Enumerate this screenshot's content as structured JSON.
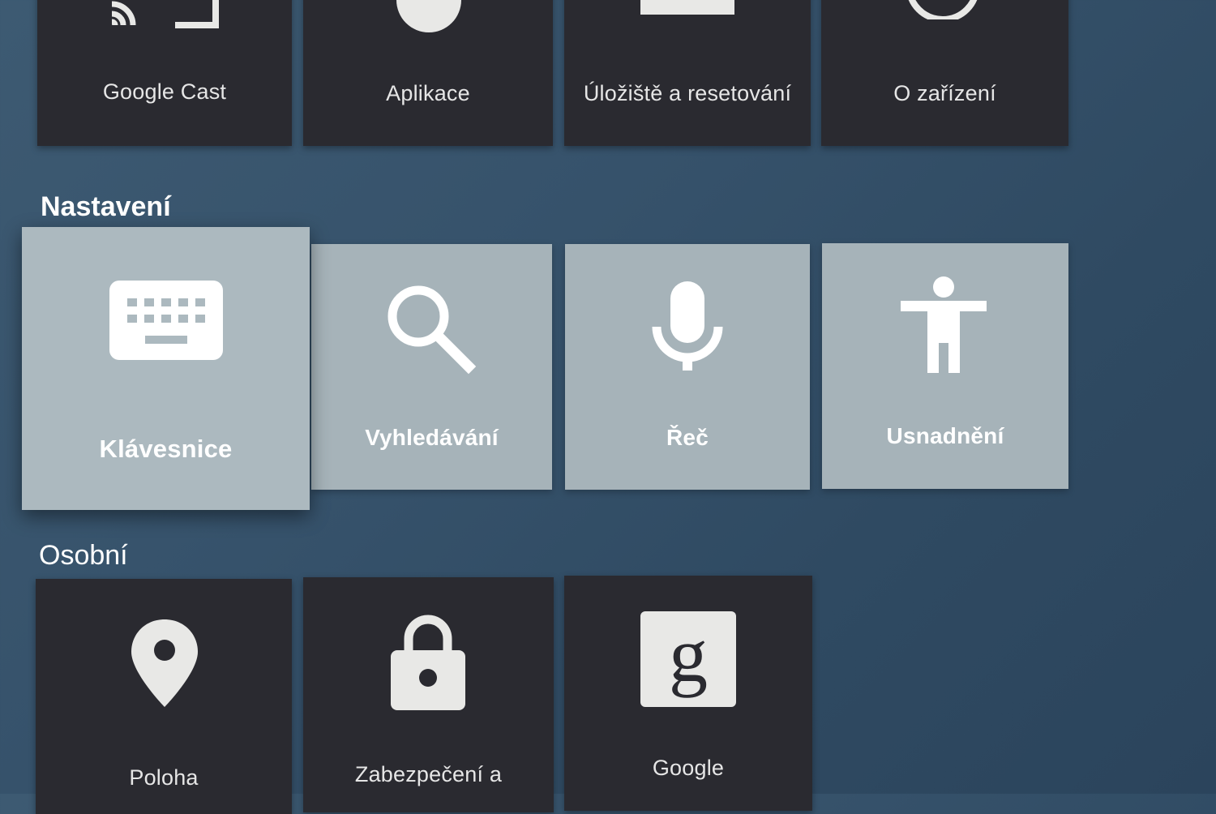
{
  "device_row": {
    "tiles": [
      {
        "label": "Google Cast",
        "icon": "cast-icon"
      },
      {
        "label": "Aplikace",
        "icon": "apps-icon"
      },
      {
        "label": "Úložiště a resetování",
        "icon": "storage-icon"
      },
      {
        "label": "O zařízení",
        "icon": "info-icon"
      }
    ]
  },
  "settings_section": {
    "title": "Nastavení",
    "tiles": [
      {
        "label": "Klávesnice",
        "icon": "keyboard-icon",
        "focused": true
      },
      {
        "label": "Vyhledávání",
        "icon": "search-icon"
      },
      {
        "label": "Řeč",
        "icon": "microphone-icon"
      },
      {
        "label": "Usnadnění",
        "icon": "accessibility-icon"
      }
    ]
  },
  "personal_section": {
    "title": "Osobní",
    "tiles": [
      {
        "label": "Poloha",
        "icon": "location-pin-icon"
      },
      {
        "label": "Zabezpečení a",
        "icon": "lock-icon"
      },
      {
        "label": "Google",
        "icon": "google-g-icon"
      }
    ]
  },
  "colors": {
    "background": "#36526b",
    "dark_tile": "#2a2a30",
    "light_tile": "#a6b3b9",
    "icon_light": "#e8e8e6",
    "icon_on_light_tile": "#ffffff"
  }
}
